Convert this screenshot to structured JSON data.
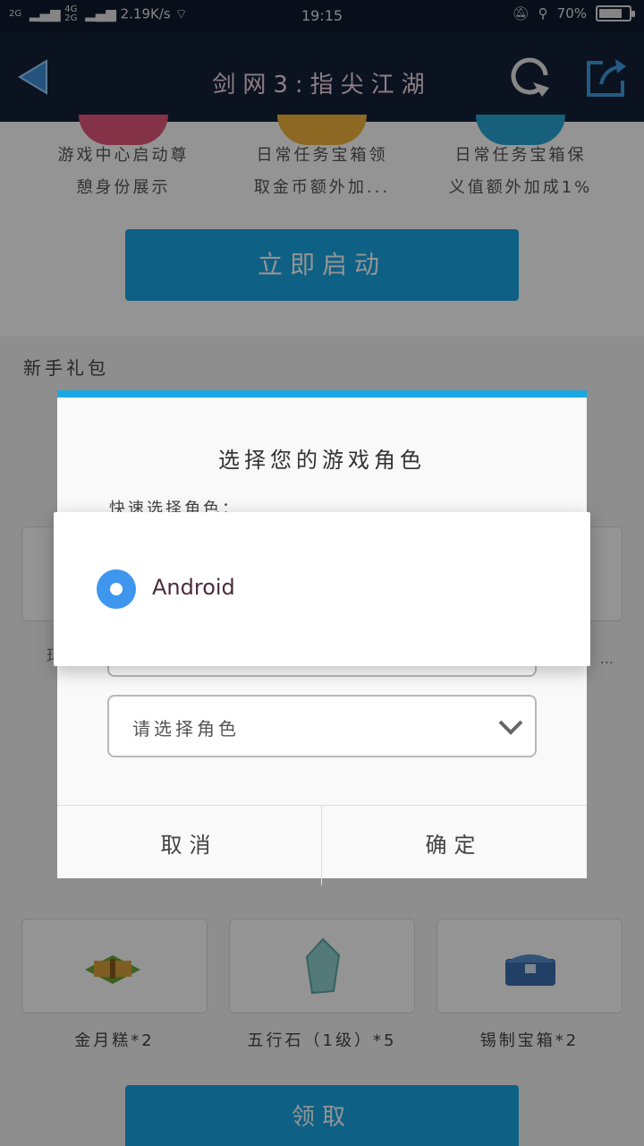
{
  "status_bar": {
    "net1": "2G",
    "net2": "4G",
    "net3": "2G",
    "speed": "2.19K/s",
    "time": "19:15",
    "battery": "70%",
    "battery_level": 0.7
  },
  "app_bar": {
    "title": "剑网3:指尖江湖",
    "back_icon": "back-arrow-icon",
    "refresh_icon": "refresh-icon",
    "share_icon": "share-icon"
  },
  "features": [
    {
      "line1": "游戏中心启动尊",
      "line2": "憩身份展示",
      "color": "#e4567a"
    },
    {
      "line1": "日常任务宝箱领",
      "line2": "取金币额外加...",
      "color": "#f2b43b"
    },
    {
      "line1": "日常任务宝箱保",
      "line2": "义值额外加成1%",
      "color": "#29a6d6"
    }
  ],
  "start_button": "立即启动",
  "gift_section_title": "新手礼包",
  "role_dialog": {
    "title": "选择您的游戏角色",
    "quick_label": "快速选择角色：",
    "select_placeholder": "请选择角色",
    "partial_left": "玛",
    "partial_right": "...",
    "cancel": "取消",
    "confirm": "确定"
  },
  "picker": {
    "option": "Android",
    "selected": true,
    "accent": "#3f96ef"
  },
  "items": [
    {
      "label": "金月糕*2"
    },
    {
      "label": "五行石（1级）*5"
    },
    {
      "label": "锡制宝箱*2"
    }
  ],
  "collect_button": "领取"
}
